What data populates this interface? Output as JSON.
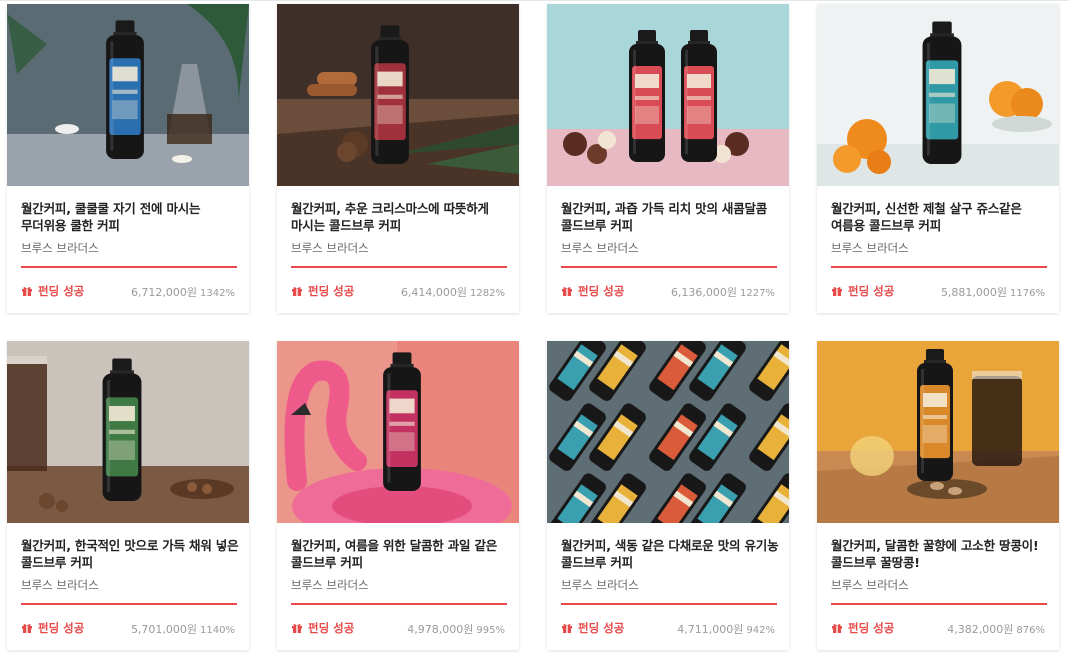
{
  "accent_color": "#e84a4a",
  "products": [
    {
      "title": "월간커피, 쿨쿨쿨 자기 전에 마시는 무더위용 쿨한 커피",
      "maker": "브루스 브라더스",
      "status": "펀딩 성공",
      "amount": "6,712,000원",
      "percent": "1342%",
      "funded_ratio": 1.0,
      "bg": "#5b6b74",
      "bg2": "#9aa3ab",
      "label": "#2a6fb0",
      "icon": "gift-icon"
    },
    {
      "title": "월간커피, 추운 크리스마스에 따뜻하게 마시는 콜드브루 커피",
      "maker": "브루스 브라더스",
      "status": "펀딩 성공",
      "amount": "6,414,000원",
      "percent": "1282%",
      "funded_ratio": 1.0,
      "bg": "#3e2f28",
      "bg2": "#6b4d3c",
      "label": "#a0303a",
      "icon": "gift-icon"
    },
    {
      "title": "월간커피, 과즙 가득 리치 맛의 새콤달콤 콜드브루 커피",
      "maker": "브루스 브라더스",
      "status": "펀딩 성공",
      "amount": "6,136,000원",
      "percent": "1227%",
      "funded_ratio": 1.0,
      "bg": "#a9d6d8",
      "bg2": "#e7b9c2",
      "label": "#d94b55",
      "icon": "gift-icon"
    },
    {
      "title": "월간커피, 신선한 제철 살구 쥬스같은 여름용 콜드브루 커피",
      "maker": "브루스 브라더스",
      "status": "펀딩 성공",
      "amount": "5,881,000원",
      "percent": "1176%",
      "funded_ratio": 1.0,
      "bg": "#eef2f2",
      "bg2": "#dfe6e6",
      "label": "#2f9aa5",
      "icon": "gift-icon"
    },
    {
      "title": "월간커피, 한국적인 맛으로 가득 채워 넣은 콜드브루 커피",
      "maker": "브루스 브라더스",
      "status": "펀딩 성공",
      "amount": "5,701,000원",
      "percent": "1140%",
      "funded_ratio": 1.0,
      "bg": "#c9c3bc",
      "bg2": "#7a5a43",
      "label": "#3f7a45",
      "icon": "gift-icon"
    },
    {
      "title": "월간커피, 여름을 위한 달콤한 과일 같은 콜드브루 커피",
      "maker": "브루스 브라더스",
      "status": "펀딩 성공",
      "amount": "4,978,000원",
      "percent": "995%",
      "funded_ratio": 1.0,
      "bg": "#e9857a",
      "bg2": "#f0a59a",
      "label": "#c2315f",
      "icon": "gift-icon"
    },
    {
      "title": "월간커피, 색동 같은 다채로운 맛의 유기농 콜드브루 커피",
      "maker": "브루스 브라더스",
      "status": "펀딩 성공",
      "amount": "4,711,000원",
      "percent": "942%",
      "funded_ratio": 1.0,
      "bg": "#5f6e75",
      "bg2": "#4b585e",
      "label": "#d95b3a",
      "icon": "gift-icon"
    },
    {
      "title": "월간커피, 달콤한 꿀향에 고소한 땅콩이! 콜드브루 꿀땅콩!",
      "maker": "브루스 브라더스",
      "status": "펀딩 성공",
      "amount": "4,382,000원",
      "percent": "876%",
      "funded_ratio": 1.0,
      "bg": "#e9a43a",
      "bg2": "#c98a52",
      "label": "#d9892a",
      "icon": "gift-icon"
    }
  ]
}
